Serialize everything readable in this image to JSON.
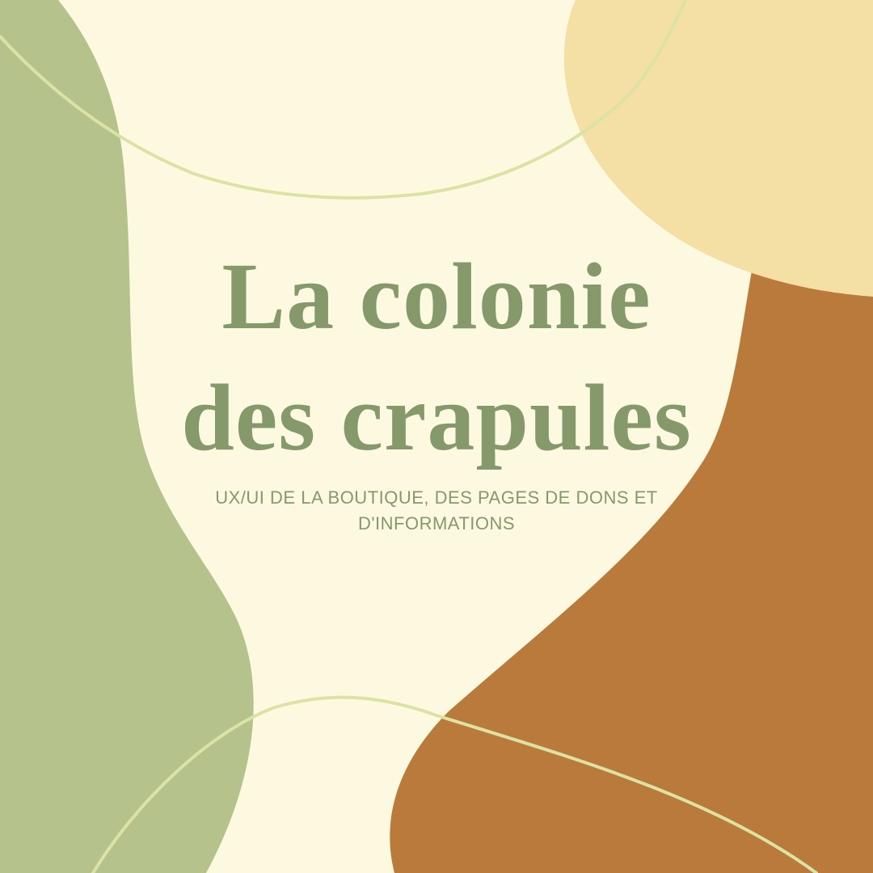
{
  "title": {
    "line1": "La colonie",
    "line2": "des crapules"
  },
  "subtitle": {
    "line1": "UX/UI DE LA BOUTIQUE, DES PAGES DE DONS ET",
    "line2": "D'INFORMATIONS"
  },
  "colors": {
    "background": "#fdf9e1",
    "green_blob": "#b5c28b",
    "sand_blob": "#f4dfa4",
    "terracotta_blob": "#ba7a3b",
    "accent_line": "#dbe3a4",
    "text": "#85996b"
  }
}
